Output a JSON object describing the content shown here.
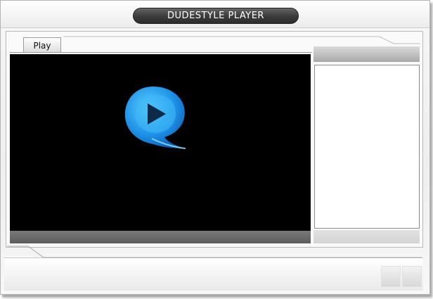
{
  "window": {
    "title": "DUDESTYLE PLAYER"
  },
  "tabs": [
    {
      "label": "Play"
    }
  ],
  "video": {
    "logo_icon": "play-logo-icon",
    "accent": "#2aa8f2"
  },
  "colors": {
    "title_bar": "#3d3d3d",
    "video_bg": "#000000",
    "control_bar": "#5c5c5c"
  }
}
